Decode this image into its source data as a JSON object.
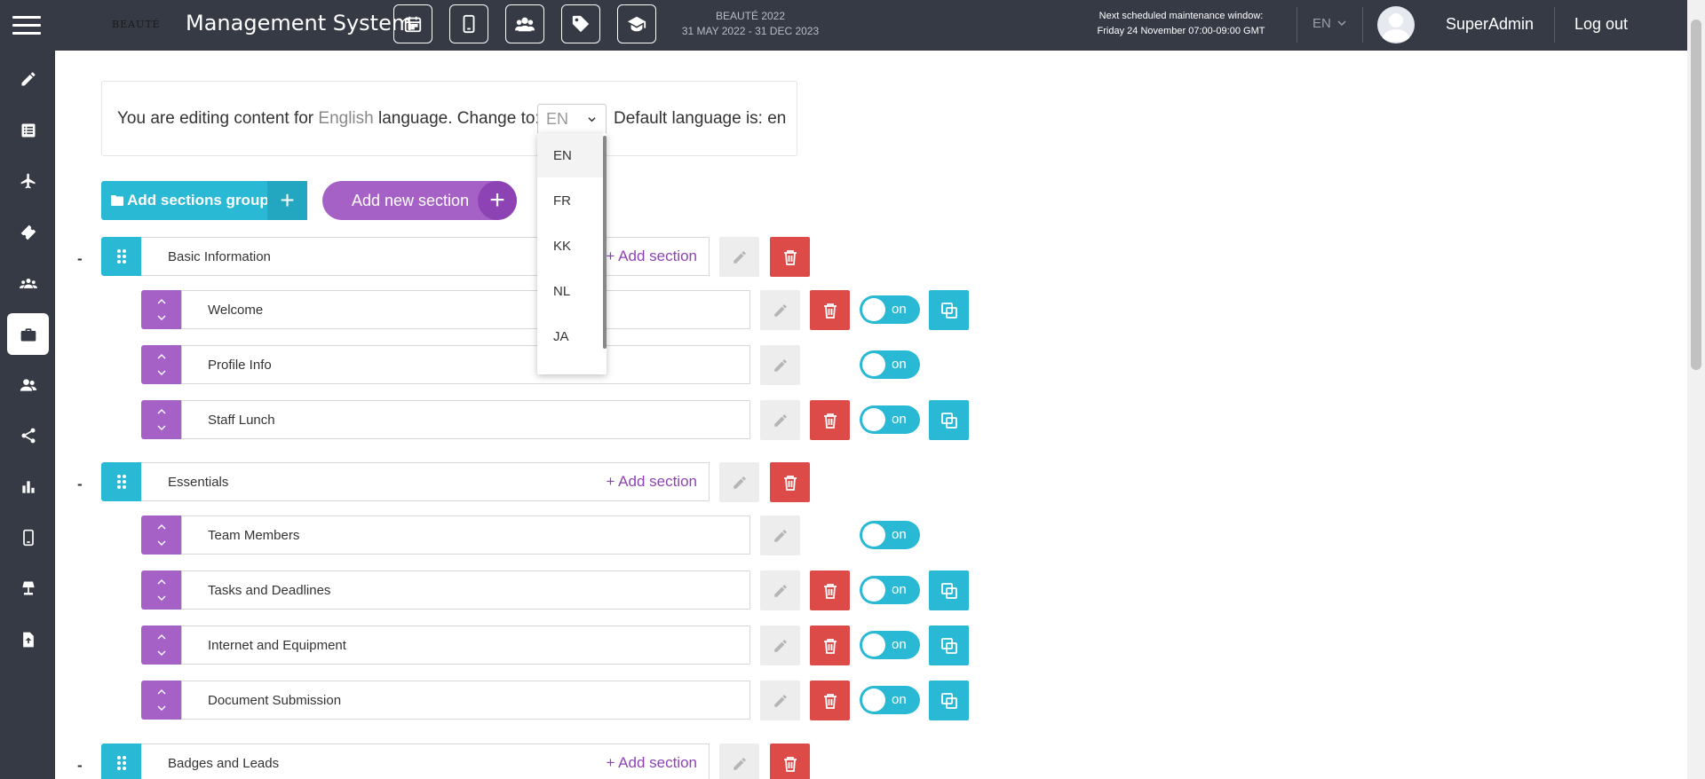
{
  "header": {
    "app_title": "Management System",
    "logo_text": "BEAUTÉ",
    "event_name": "BEAUTÉ 2022",
    "event_dates": "31 MAY 2022 - 31 DEC 2023",
    "maintenance_title": "Next scheduled maintenance window:",
    "maintenance_when": "Friday 24 November 07:00-09:00 GMT",
    "language": "EN",
    "user_name": "SuperAdmin",
    "logout_label": "Log out",
    "nav_icons": [
      "calendar-icon",
      "mobile-icon",
      "users-icon",
      "tag-icon",
      "graduation-cap-icon"
    ]
  },
  "sidebar": {
    "items": [
      "pencil-icon",
      "list-icon",
      "plane-icon",
      "ticket-icon",
      "group-icon",
      "briefcase-icon",
      "users-icon",
      "share-icon",
      "bar-chart-icon",
      "mobile-icon",
      "lamp-icon",
      "upload-file-icon"
    ],
    "active_item": "briefcase-icon"
  },
  "language_bar": {
    "prefix": "You are editing content for ",
    "language": "English",
    "suffix": " language. Change to:",
    "selected": "EN",
    "default_text": "Default language is: en",
    "options": [
      "EN",
      "FR",
      "KK",
      "NL",
      "JA"
    ]
  },
  "actions": {
    "add_group_label": "Add sections group",
    "add_group_plus": "+",
    "add_section_label": "Add new section",
    "add_section_plus": "+"
  },
  "groups": [
    {
      "name": "Basic Information",
      "collapse": "-",
      "add_section_label": "+ Add section",
      "sections": [
        {
          "name": "Welcome",
          "toggle": "on",
          "deletable": true,
          "copyable": true
        },
        {
          "name": "Profile Info",
          "toggle": "on",
          "deletable": false,
          "copyable": false
        },
        {
          "name": "Staff Lunch",
          "toggle": "on",
          "deletable": true,
          "copyable": true
        }
      ]
    },
    {
      "name": "Essentials",
      "collapse": "-",
      "add_section_label": "+ Add section",
      "sections": [
        {
          "name": "Team Members",
          "toggle": "on",
          "deletable": false,
          "copyable": false
        },
        {
          "name": "Tasks and Deadlines",
          "toggle": "on",
          "deletable": true,
          "copyable": true
        },
        {
          "name": "Internet and Equipment",
          "toggle": "on",
          "deletable": true,
          "copyable": true
        },
        {
          "name": "Document Submission",
          "toggle": "on",
          "deletable": true,
          "copyable": true
        }
      ]
    },
    {
      "name": "Badges and Leads",
      "collapse": "-",
      "add_section_label": "+ Add section",
      "sections": []
    }
  ],
  "colors": {
    "sidebar_bg": "#353a45",
    "accent_cyan": "#29b9d4",
    "accent_purple": "#a661c6",
    "danger_red": "#dc4b48"
  }
}
